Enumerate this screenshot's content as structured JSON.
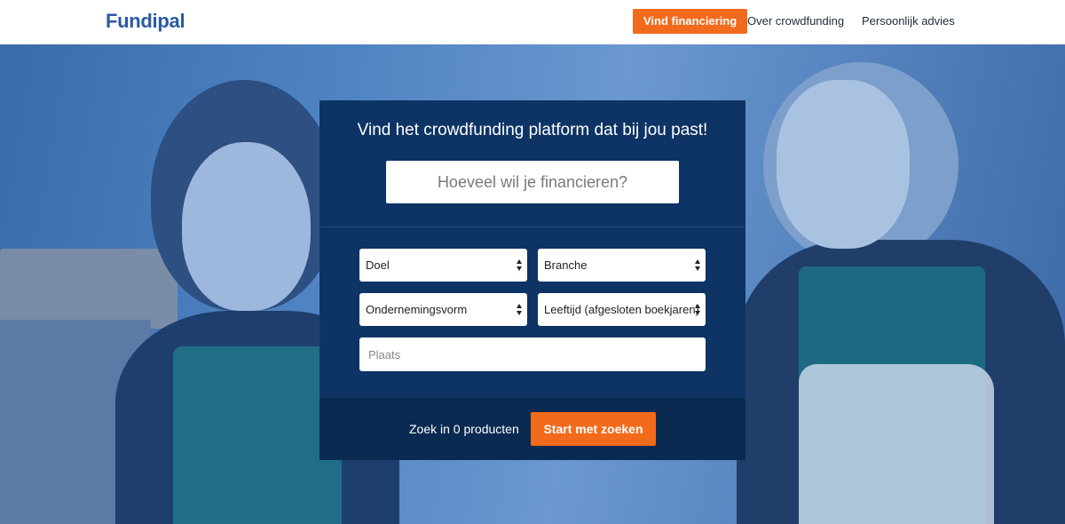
{
  "header": {
    "logo": "Fundipal",
    "nav": {
      "primary": "Vind financiering",
      "item2": "Over crowdfunding",
      "item3": "Persoonlijk advies"
    }
  },
  "panel": {
    "title": "Vind het crowdfunding platform dat bij jou past!",
    "amount_placeholder": "Hoeveel wil je financieren?",
    "selects": {
      "doel": "Doel",
      "branche": "Branche",
      "vorm": "Ondernemingsvorm",
      "leeftijd": "Leeftijd (afgesloten boekjaren)"
    },
    "place_placeholder": "Plaats",
    "search_count": "Zoek in 0 producten",
    "start_button": "Start met zoeken"
  },
  "colors": {
    "brand_blue": "#2b5aa0",
    "panel_blue": "#0e3466",
    "accent_orange": "#f26a1b"
  }
}
